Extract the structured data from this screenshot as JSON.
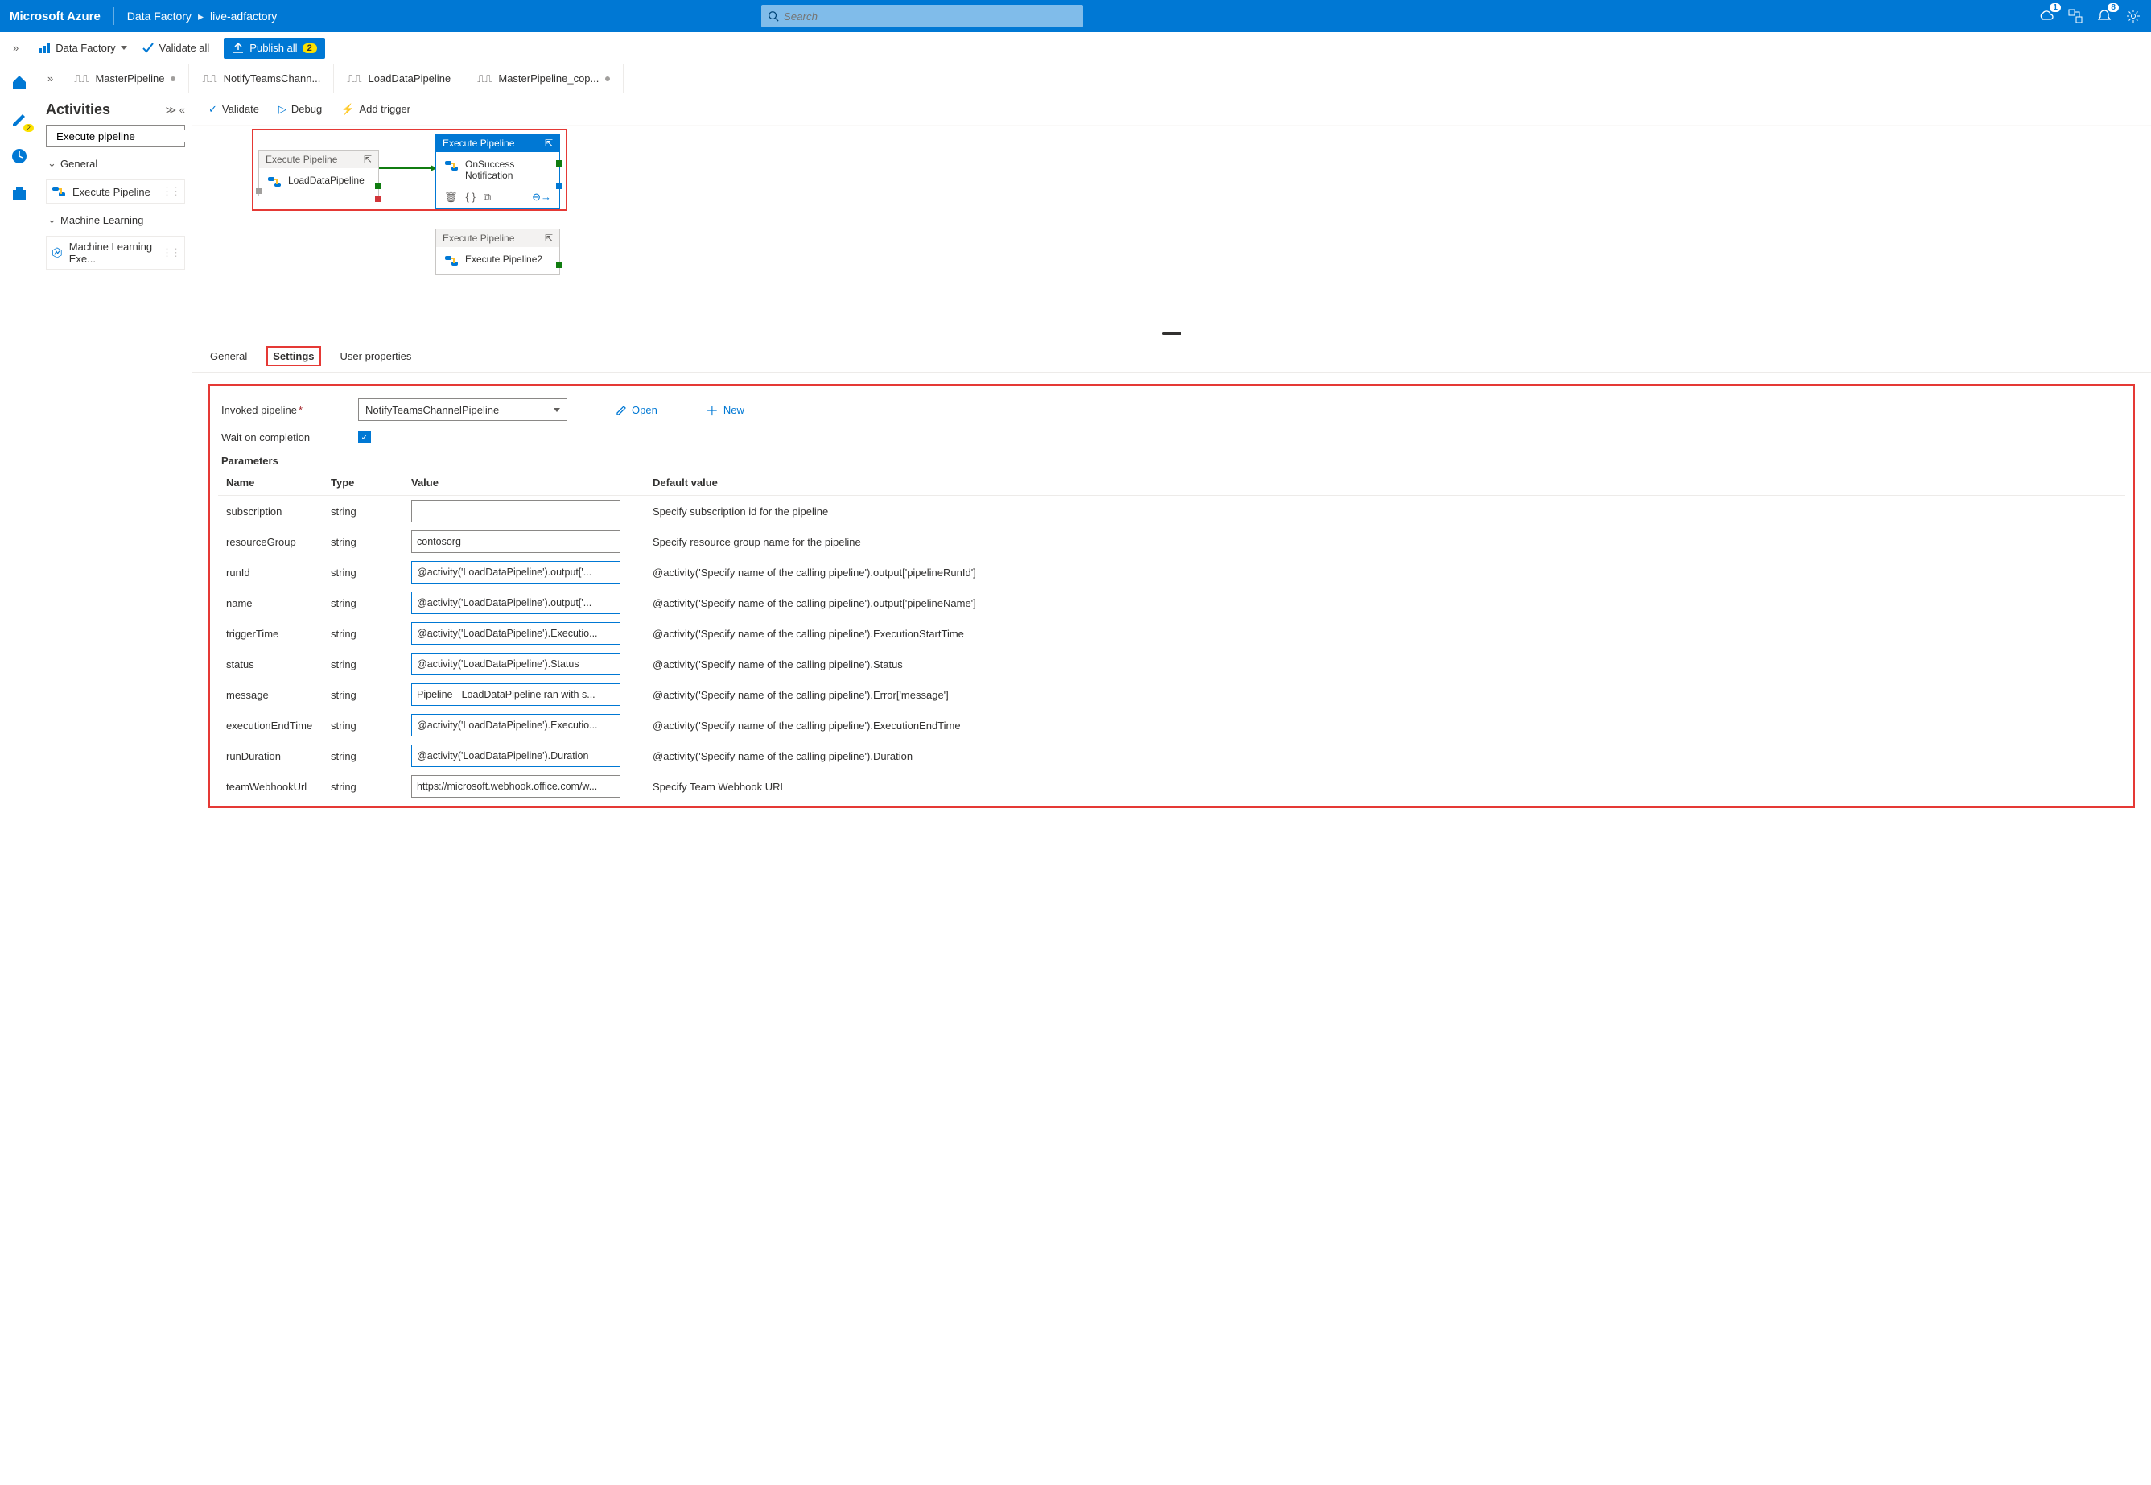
{
  "header": {
    "brand": "Microsoft Azure",
    "breadcrumb": [
      "Data Factory",
      "live-adfactory"
    ],
    "search_placeholder": "Search",
    "notif_badge": "1",
    "bell_badge": "8"
  },
  "toolbar": {
    "factory_label": "Data Factory",
    "validate_all": "Validate all",
    "publish_all": "Publish all",
    "publish_count": "2"
  },
  "rail": {
    "pencil_badge": "2"
  },
  "tabs": [
    {
      "label": "MasterPipeline",
      "dirty": true,
      "active": true
    },
    {
      "label": "NotifyTeamsChann...",
      "dirty": false,
      "active": false
    },
    {
      "label": "LoadDataPipeline",
      "dirty": false,
      "active": false
    },
    {
      "label": "MasterPipeline_cop...",
      "dirty": true,
      "active": false
    }
  ],
  "activities": {
    "title": "Activities",
    "search_value": "Execute pipeline",
    "groups": [
      {
        "name": "General",
        "items": [
          {
            "label": "Execute Pipeline",
            "icon": "pipeline"
          }
        ]
      },
      {
        "name": "Machine Learning",
        "items": [
          {
            "label": "Machine Learning Exe...",
            "icon": "ml"
          }
        ]
      }
    ]
  },
  "canvas_toolbar": {
    "validate": "Validate",
    "debug": "Debug",
    "add_trigger": "Add trigger"
  },
  "canvas": {
    "node1": {
      "type": "Execute Pipeline",
      "name": "LoadDataPipeline"
    },
    "node2": {
      "type": "Execute Pipeline",
      "name_l1": "OnSuccess",
      "name_l2": "Notification"
    },
    "node3": {
      "type": "Execute Pipeline",
      "name": "Execute Pipeline2"
    }
  },
  "bottom_tabs": {
    "general": "General",
    "settings": "Settings",
    "user_props": "User properties"
  },
  "settings": {
    "invoked_label": "Invoked pipeline",
    "invoked_value": "NotifyTeamsChannelPipeline",
    "open": "Open",
    "new": "New",
    "wait_label": "Wait on completion",
    "wait_checked": true,
    "params_label": "Parameters",
    "cols": {
      "name": "Name",
      "type": "Type",
      "value": "Value",
      "default": "Default value"
    }
  },
  "params": [
    {
      "name": "subscription",
      "type": "string",
      "value": "",
      "default": "Specify subscription id for the pipeline",
      "plain": true
    },
    {
      "name": "resourceGroup",
      "type": "string",
      "value": "contosorg",
      "default": "Specify resource group name for the pipeline",
      "plain": true
    },
    {
      "name": "runId",
      "type": "string",
      "value": "@activity('LoadDataPipeline').output['...",
      "default": "@activity('Specify name of the calling pipeline').output['pipelineRunId']"
    },
    {
      "name": "name",
      "type": "string",
      "value": "@activity('LoadDataPipeline').output['...",
      "default": "@activity('Specify name of the calling pipeline').output['pipelineName']"
    },
    {
      "name": "triggerTime",
      "type": "string",
      "value": "@activity('LoadDataPipeline').Executio...",
      "default": "@activity('Specify name of the calling pipeline').ExecutionStartTime"
    },
    {
      "name": "status",
      "type": "string",
      "value": "@activity('LoadDataPipeline').Status",
      "default": "@activity('Specify name of the calling pipeline').Status"
    },
    {
      "name": "message",
      "type": "string",
      "value": "Pipeline - LoadDataPipeline ran with s...",
      "default": "@activity('Specify name of the calling pipeline').Error['message']"
    },
    {
      "name": "executionEndTime",
      "type": "string",
      "value": "@activity('LoadDataPipeline').Executio...",
      "default": "@activity('Specify name of the calling pipeline').ExecutionEndTime"
    },
    {
      "name": "runDuration",
      "type": "string",
      "value": "@activity('LoadDataPipeline').Duration",
      "default": "@activity('Specify name of the calling pipeline').Duration"
    },
    {
      "name": "teamWebhookUrl",
      "type": "string",
      "value": "https://microsoft.webhook.office.com/w...",
      "default": "Specify Team Webhook URL",
      "plain": true
    }
  ]
}
